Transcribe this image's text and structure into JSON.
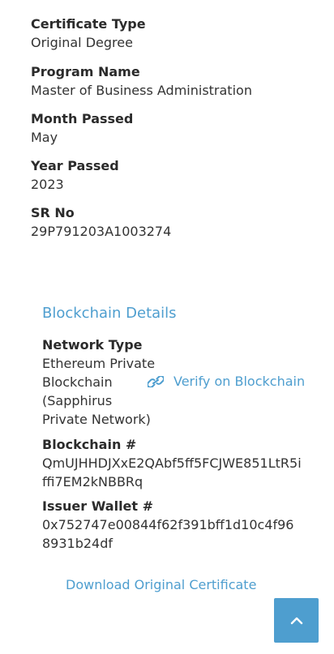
{
  "certificate_details": [
    {
      "label": "Certificate Type",
      "value": "Original Degree"
    },
    {
      "label": "Program Name",
      "value": "Master of Business Administration"
    },
    {
      "label": "Month Passed",
      "value": "May"
    },
    {
      "label": "Year Passed",
      "value": "2023"
    },
    {
      "label": "SR No",
      "value": "29P791203A1003274"
    }
  ],
  "blockchain": {
    "title": "Blockchain Details",
    "network_type_label": "Network Type",
    "network_type_value": "Ethereum Private Blockchain (Sapphirus Private Network)",
    "verify_label": "Verify on Blockchain",
    "verify_icon": "link-icon",
    "hash_label": "Blockchain #",
    "hash_value": "QmUJHHDJXxE2QAbf5ff5FCJWE851LtR5iffi7EM2kNBBRq",
    "wallet_label": "Issuer Wallet #",
    "wallet_value": "0x752747e00844f62f391bff1d10c4f968931b24df"
  },
  "download_label": "Download Original Certificate",
  "scroll_top_icon": "chevron-up-icon",
  "colors": {
    "accent": "#4e9ecf",
    "text": "#2b2b2b",
    "background": "#ffffff"
  }
}
